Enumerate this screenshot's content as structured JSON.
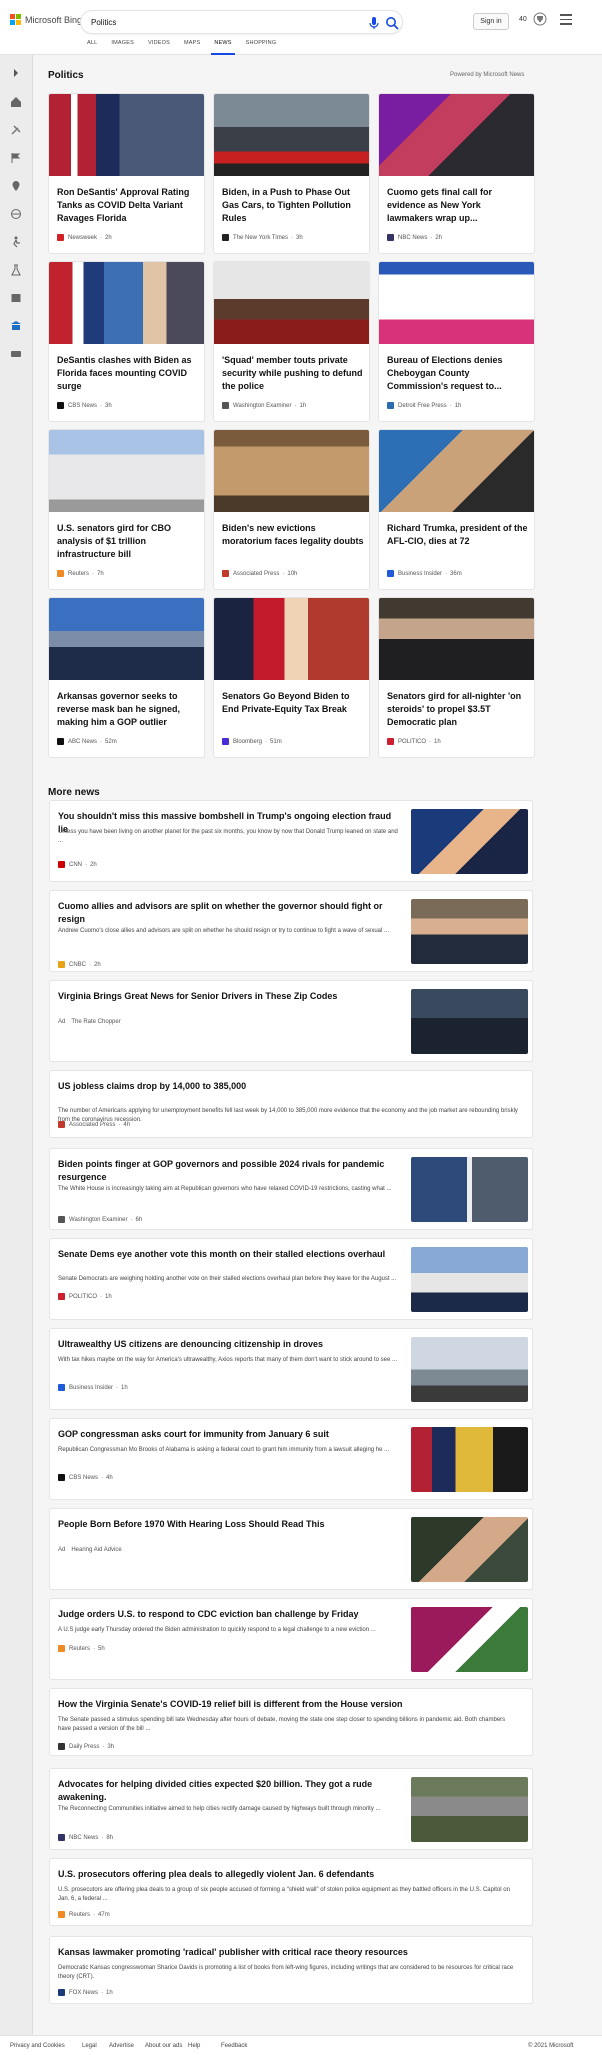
{
  "header": {
    "brand": "Microsoft Bing",
    "search_value": "Politics",
    "signin": "Sign in",
    "points": "40",
    "tabs": [
      "ALL",
      "IMAGES",
      "VIDEOS",
      "MAPS",
      "NEWS",
      "SHOPPING"
    ],
    "active_tab": "NEWS"
  },
  "section": {
    "title": "Politics",
    "powered": "Powered by Microsoft News"
  },
  "cards": [
    {
      "title": "Ron DeSantis' Approval Rating Tanks as COVID Delta Variant Ravages Florida",
      "source": "Newsweek",
      "time": "2h",
      "fav_color": "#d22027"
    },
    {
      "title": "Biden, in a Push to Phase Out Gas Cars, to Tighten Pollution Rules",
      "source": "The New York Times",
      "time": "3h",
      "fav_color": "#222222"
    },
    {
      "title": "Cuomo gets final call for evidence as New York lawmakers wrap up...",
      "source": "NBC News",
      "time": "2h",
      "fav_color": "#333366"
    },
    {
      "title": "DeSantis clashes with Biden as Florida faces mounting COVID surge",
      "source": "CBS News",
      "time": "3h",
      "fav_color": "#111111"
    },
    {
      "title": "'Squad' member touts private security while pushing to defund the police",
      "source": "Washington Examiner",
      "time": "1h",
      "fav_color": "#555555"
    },
    {
      "title": "Bureau of Elections denies Cheboygan County Commission's request to...",
      "source": "Detroit Free Press",
      "time": "1h",
      "fav_color": "#2b6cb0"
    },
    {
      "title": "U.S. senators gird for CBO analysis of $1 trillion infrastructure bill",
      "source": "Reuters",
      "time": "7h",
      "fav_color": "#f08a24"
    },
    {
      "title": "Biden's new evictions moratorium faces legality doubts",
      "source": "Associated Press",
      "time": "10h",
      "fav_color": "#c0392b"
    },
    {
      "title": "Richard Trumka, president of the AFL-CIO, dies at 72",
      "source": "Business Insider",
      "time": "36m",
      "fav_color": "#1f5bd8"
    },
    {
      "title": "Arkansas governor seeks to reverse mask ban he signed, making him a GOP outlier",
      "source": "ABC News",
      "time": "52m",
      "fav_color": "#111111"
    },
    {
      "title": "Senators Go Beyond Biden to End Private-Equity Tax Break",
      "source": "Bloomberg",
      "time": "51m",
      "fav_color": "#4b2ad8"
    },
    {
      "title": "Senators gird for all-nighter 'on steroids' to propel $3.5T Democratic plan",
      "source": "POLITICO",
      "time": "1h",
      "fav_color": "#cc1f2f"
    }
  ],
  "more_news_title": "More news",
  "more_news": [
    {
      "title": "You shouldn't miss this massive bombshell in Trump's ongoing election fraud lie",
      "snippet": "Unless you have been living on another planet for the past six months, you know by now that Donald Trump leaned on state and ...",
      "source": "CNN",
      "time": "2h",
      "fav_color": "#cc0000"
    },
    {
      "title": "Cuomo allies and advisors are split on whether the governor should fight or resign",
      "snippet": "Andrew Cuomo's close allies and advisors are split on whether he should resign or try to continue to fight a wave of sexual ...",
      "source": "CNBC",
      "time": "2h",
      "fav_color": "#e8a317"
    },
    {
      "title": "Virginia Brings Great News for Senior Drivers in These Zip Codes",
      "ad": "Ad",
      "source": "The Rate Chopper",
      "fav_color": "#ffffff"
    },
    {
      "title": "US jobless claims drop by 14,000 to 385,000",
      "snippet": "The number of Americans applying for unemployment benefits fell last week by 14,000 to 385,000 more evidence that the economy and the job market are rebounding briskly from the coronavirus recession.",
      "source": "Associated Press",
      "time": "4h",
      "fav_color": "#c0392b"
    },
    {
      "title": "Biden points finger at GOP governors and possible 2024 rivals for pandemic resurgence",
      "snippet": "The White House is increasingly taking aim at Republican governors who have relaxed COVID-19 restrictions, casting what ...",
      "source": "Washington Examiner",
      "time": "6h",
      "fav_color": "#555555"
    },
    {
      "title": "Senate Dems eye another vote this month on their stalled elections overhaul",
      "snippet": "Senate Democrats are weighing holding another vote on their stalled elections overhaul plan before they leave for the August ...",
      "source": "POLITICO",
      "time": "1h",
      "fav_color": "#cc1f2f"
    },
    {
      "title": "Ultrawealthy US citizens are denouncing citizenship in droves",
      "snippet": "With tax hikes maybe on the way for America's ultrawealthy, Axios reports that many of them don't want to stick around to see ...",
      "source": "Business Insider",
      "time": "1h",
      "fav_color": "#1f5bd8"
    },
    {
      "title": "GOP congressman asks court for immunity from January 6 suit",
      "snippet": "Republican Congressman Mo Brooks of Alabama is asking a federal court to grant him immunity from a lawsuit alleging he ...",
      "source": "CBS News",
      "time": "4h",
      "fav_color": "#111111"
    },
    {
      "title": "People Born Before 1970 With Hearing Loss Should Read This",
      "ad": "Ad",
      "source": "Hearing Aid Advice",
      "fav_color": "#ffffff"
    },
    {
      "title": "Judge orders U.S. to respond to CDC eviction ban challenge by Friday",
      "snippet": "A U.S judge early Thursday ordered the Biden administration to quickly respond to a legal challenge to a new eviction ...",
      "source": "Reuters",
      "time": "5h",
      "fav_color": "#f08a24"
    },
    {
      "title": "How the Virginia Senate's COVID-19 relief bill is different from the House version",
      "snippet": "The Senate passed a stimulus spending bill late Wednesday after hours of debate, moving the state one step closer to spending billions in pandemic aid. Both chambers have passed a version of the bill ...",
      "source": "Daily Press",
      "time": "3h",
      "fav_color": "#333333"
    },
    {
      "title": "Advocates for helping divided cities expected $20 billion. They got a rude awakening.",
      "snippet": "The Reconnecting Communities initiative aimed to help cities rectify damage caused by highways built through minority ...",
      "source": "NBC News",
      "time": "8h",
      "fav_color": "#333366"
    },
    {
      "title": "U.S. prosecutors offering plea deals to allegedly violent Jan. 6 defendants",
      "snippet": "U.S. prosecutors are offering plea deals to a group of six people accused of forming a \"shield wall\" of stolen police equipment as they battled officers in the U.S. Capitol on Jan. 6, a federal ...",
      "source": "Reuters",
      "time": "47m",
      "fav_color": "#f08a24"
    },
    {
      "title": "Kansas lawmaker promoting 'radical' publisher with critical race theory resources",
      "snippet": "Democratic Kansas congresswoman Sharice Davids is promoting a list of books from left-wing figures, including writings that are considered to be resources for critical race theory (CRT).",
      "source": "FOX News",
      "time": "1h",
      "fav_color": "#1a3a7a"
    }
  ],
  "footer": {
    "links": [
      "Privacy and Cookies",
      "Legal",
      "Advertise",
      "About our ads",
      "Help",
      "Feedback"
    ],
    "copyright": "© 2021 Microsoft"
  }
}
